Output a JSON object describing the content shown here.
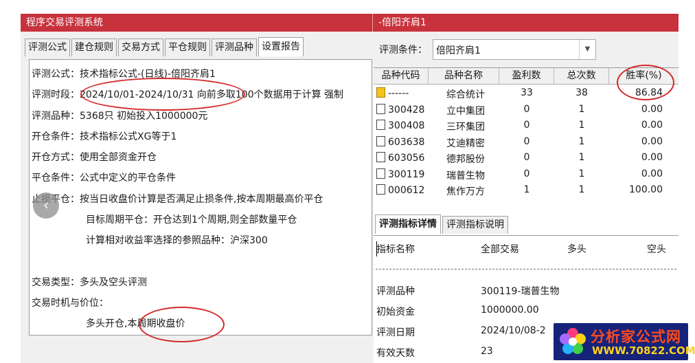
{
  "left_window": {
    "title": "程序交易评测系统",
    "tabs": [
      {
        "label": "评测公式"
      },
      {
        "label": "建仓规则"
      },
      {
        "label": "交易方式"
      },
      {
        "label": "平仓规则"
      },
      {
        "label": "评测品种"
      },
      {
        "label": "设置报告"
      }
    ],
    "active_tab": "设置报告",
    "report_lines": [
      "评测公式：技术指标公式-(日线)-倍阳齐肩1",
      "评测时段：2024/10/01-2024/10/31 向前多取100个数据用于计算 强制",
      "评测品种：5368只 初始投入1000000元",
      "开仓条件：技术指标公式XG等于1",
      "开仓方式：使用全部资金开仓",
      "平仓条件：公式中定义的平仓条件",
      "止损平仓：按当日收盘价计算是否满足止损条件,按本周期最高价平仓",
      "目标周期平仓：开仓达到1个周期,则全部数量平仓",
      "计算相对收益率选择的参照品种：沪深300",
      "交易类型：多头及空头评测",
      "交易时机与价位：",
      "多头开仓,本周期收盘价"
    ]
  },
  "right_window": {
    "title": "-倍阳齐肩1",
    "condition_label": "评测条件：",
    "condition_value": "倍阳齐肩1",
    "grid_headers": [
      "品种代码",
      "品种名称",
      "盈利数",
      "总次数",
      "胜率(%)"
    ],
    "grid_rows": [
      {
        "code": "------",
        "name": "综合统计",
        "profit": "33",
        "total": "38",
        "rate": "86.84",
        "icon": "summary-folder-icon"
      },
      {
        "code": "300428",
        "name": "立中集团",
        "profit": "0",
        "total": "1",
        "rate": "0.00",
        "icon": "document-icon"
      },
      {
        "code": "300408",
        "name": "三环集团",
        "profit": "0",
        "total": "1",
        "rate": "0.00",
        "icon": "document-icon"
      },
      {
        "code": "603638",
        "name": "艾迪精密",
        "profit": "0",
        "total": "1",
        "rate": "0.00",
        "icon": "document-icon"
      },
      {
        "code": "603056",
        "name": "德邦股份",
        "profit": "0",
        "total": "1",
        "rate": "0.00",
        "icon": "document-icon"
      },
      {
        "code": "300119",
        "name": "瑞普生物",
        "profit": "0",
        "total": "1",
        "rate": "0.00",
        "icon": "document-icon"
      },
      {
        "code": "000612",
        "name": "焦作万方",
        "profit": "1",
        "total": "1",
        "rate": "100.00",
        "icon": "document-icon"
      }
    ],
    "detail_tabs": [
      {
        "label": "评测指标详情"
      },
      {
        "label": "评测指标说明"
      }
    ],
    "detail_headers": [
      "指标名称",
      "全部交易",
      "多头",
      "空头"
    ],
    "detail_rows": [
      {
        "name": "评测品种",
        "value": "300119-瑞普生物"
      },
      {
        "name": "初始资金",
        "value": "1000000.00"
      },
      {
        "name": "评测日期",
        "value": "2024/10/08-2"
      },
      {
        "name": "有效天数",
        "value": "23"
      }
    ]
  },
  "watermark": {
    "line1": "分析家公式网",
    "line2": "WWW.70822.COM"
  },
  "colors": {
    "titlebar": "#c8323c",
    "annotation": "#d42a2a",
    "watermark_bg": "#16237a"
  }
}
